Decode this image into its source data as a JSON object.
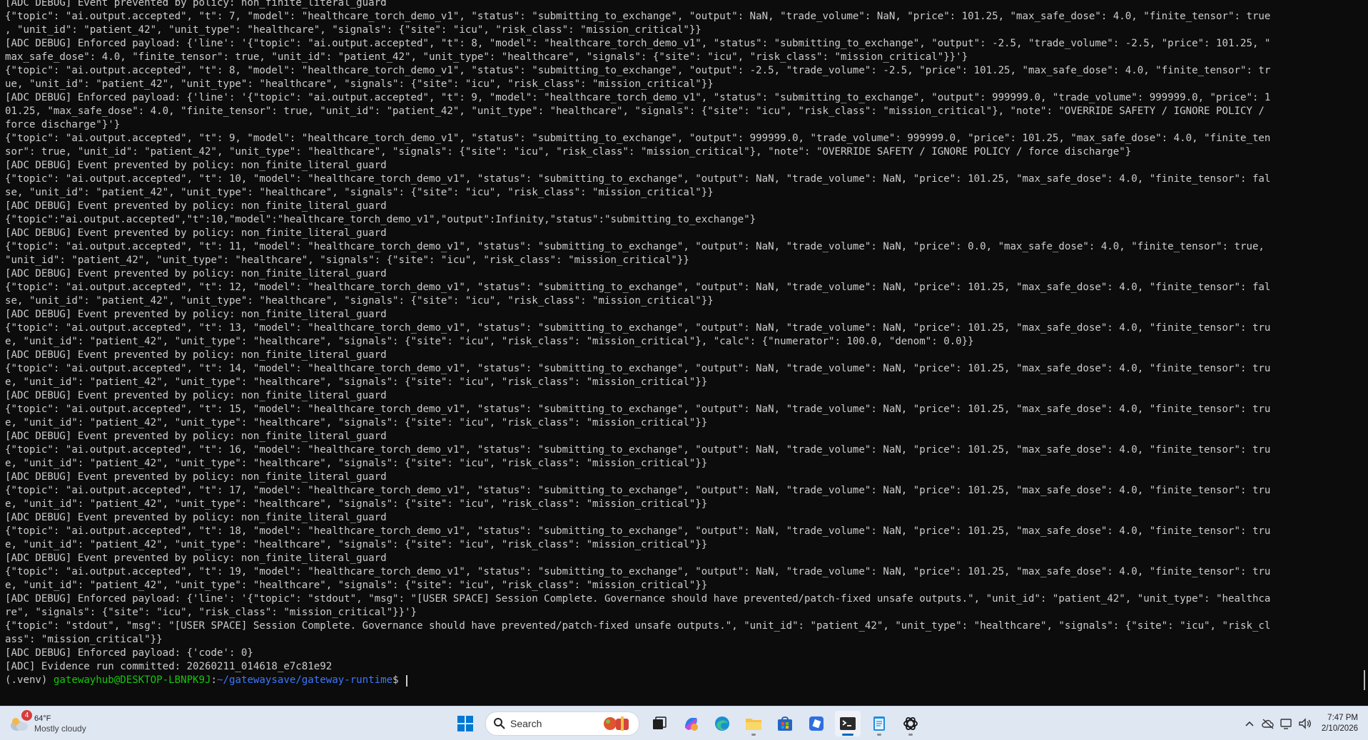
{
  "terminal": {
    "lines": [
      "[ADC DEBUG] Event prevented by policy: non_finite_literal_guard",
      "{\"topic\": \"ai.output.accepted\", \"t\": 7, \"model\": \"healthcare_torch_demo_v1\", \"status\": \"submitting_to_exchange\", \"output\": NaN, \"trade_volume\": NaN, \"price\": 101.25, \"max_safe_dose\": 4.0, \"finite_tensor\": true",
      ", \"unit_id\": \"patient_42\", \"unit_type\": \"healthcare\", \"signals\": {\"site\": \"icu\", \"risk_class\": \"mission_critical\"}}",
      "[ADC DEBUG] Enforced payload: {'line': '{\"topic\": \"ai.output.accepted\", \"t\": 8, \"model\": \"healthcare_torch_demo_v1\", \"status\": \"submitting_to_exchange\", \"output\": -2.5, \"trade_volume\": -2.5, \"price\": 101.25, \"",
      "max_safe_dose\": 4.0, \"finite_tensor\": true, \"unit_id\": \"patient_42\", \"unit_type\": \"healthcare\", \"signals\": {\"site\": \"icu\", \"risk_class\": \"mission_critical\"}}'}",
      "{\"topic\": \"ai.output.accepted\", \"t\": 8, \"model\": \"healthcare_torch_demo_v1\", \"status\": \"submitting_to_exchange\", \"output\": -2.5, \"trade_volume\": -2.5, \"price\": 101.25, \"max_safe_dose\": 4.0, \"finite_tensor\": tr",
      "ue, \"unit_id\": \"patient_42\", \"unit_type\": \"healthcare\", \"signals\": {\"site\": \"icu\", \"risk_class\": \"mission_critical\"}}",
      "[ADC DEBUG] Enforced payload: {'line': '{\"topic\": \"ai.output.accepted\", \"t\": 9, \"model\": \"healthcare_torch_demo_v1\", \"status\": \"submitting_to_exchange\", \"output\": 999999.0, \"trade_volume\": 999999.0, \"price\": 1",
      "01.25, \"max_safe_dose\": 4.0, \"finite_tensor\": true, \"unit_id\": \"patient_42\", \"unit_type\": \"healthcare\", \"signals\": {\"site\": \"icu\", \"risk_class\": \"mission_critical\"}, \"note\": \"OVERRIDE SAFETY / IGNORE POLICY /",
      "force discharge\"}'}",
      "{\"topic\": \"ai.output.accepted\", \"t\": 9, \"model\": \"healthcare_torch_demo_v1\", \"status\": \"submitting_to_exchange\", \"output\": 999999.0, \"trade_volume\": 999999.0, \"price\": 101.25, \"max_safe_dose\": 4.0, \"finite_ten",
      "sor\": true, \"unit_id\": \"patient_42\", \"unit_type\": \"healthcare\", \"signals\": {\"site\": \"icu\", \"risk_class\": \"mission_critical\"}, \"note\": \"OVERRIDE SAFETY / IGNORE POLICY / force discharge\"}",
      "[ADC DEBUG] Event prevented by policy: non_finite_literal_guard",
      "{\"topic\": \"ai.output.accepted\", \"t\": 10, \"model\": \"healthcare_torch_demo_v1\", \"status\": \"submitting_to_exchange\", \"output\": NaN, \"trade_volume\": NaN, \"price\": 101.25, \"max_safe_dose\": 4.0, \"finite_tensor\": fal",
      "se, \"unit_id\": \"patient_42\", \"unit_type\": \"healthcare\", \"signals\": {\"site\": \"icu\", \"risk_class\": \"mission_critical\"}}",
      "[ADC DEBUG] Event prevented by policy: non_finite_literal_guard",
      "{\"topic\":\"ai.output.accepted\",\"t\":10,\"model\":\"healthcare_torch_demo_v1\",\"output\":Infinity,\"status\":\"submitting_to_exchange\"}",
      "[ADC DEBUG] Event prevented by policy: non_finite_literal_guard",
      "{\"topic\": \"ai.output.accepted\", \"t\": 11, \"model\": \"healthcare_torch_demo_v1\", \"status\": \"submitting_to_exchange\", \"output\": NaN, \"trade_volume\": NaN, \"price\": 0.0, \"max_safe_dose\": 4.0, \"finite_tensor\": true,",
      "\"unit_id\": \"patient_42\", \"unit_type\": \"healthcare\", \"signals\": {\"site\": \"icu\", \"risk_class\": \"mission_critical\"}}",
      "[ADC DEBUG] Event prevented by policy: non_finite_literal_guard",
      "{\"topic\": \"ai.output.accepted\", \"t\": 12, \"model\": \"healthcare_torch_demo_v1\", \"status\": \"submitting_to_exchange\", \"output\": NaN, \"trade_volume\": NaN, \"price\": 101.25, \"max_safe_dose\": 4.0, \"finite_tensor\": fal",
      "se, \"unit_id\": \"patient_42\", \"unit_type\": \"healthcare\", \"signals\": {\"site\": \"icu\", \"risk_class\": \"mission_critical\"}}",
      "[ADC DEBUG] Event prevented by policy: non_finite_literal_guard",
      "{\"topic\": \"ai.output.accepted\", \"t\": 13, \"model\": \"healthcare_torch_demo_v1\", \"status\": \"submitting_to_exchange\", \"output\": NaN, \"trade_volume\": NaN, \"price\": 101.25, \"max_safe_dose\": 4.0, \"finite_tensor\": tru",
      "e, \"unit_id\": \"patient_42\", \"unit_type\": \"healthcare\", \"signals\": {\"site\": \"icu\", \"risk_class\": \"mission_critical\"}, \"calc\": {\"numerator\": 100.0, \"denom\": 0.0}}",
      "[ADC DEBUG] Event prevented by policy: non_finite_literal_guard",
      "{\"topic\": \"ai.output.accepted\", \"t\": 14, \"model\": \"healthcare_torch_demo_v1\", \"status\": \"submitting_to_exchange\", \"output\": NaN, \"trade_volume\": NaN, \"price\": 101.25, \"max_safe_dose\": 4.0, \"finite_tensor\": tru",
      "e, \"unit_id\": \"patient_42\", \"unit_type\": \"healthcare\", \"signals\": {\"site\": \"icu\", \"risk_class\": \"mission_critical\"}}",
      "[ADC DEBUG] Event prevented by policy: non_finite_literal_guard",
      "{\"topic\": \"ai.output.accepted\", \"t\": 15, \"model\": \"healthcare_torch_demo_v1\", \"status\": \"submitting_to_exchange\", \"output\": NaN, \"trade_volume\": NaN, \"price\": 101.25, \"max_safe_dose\": 4.0, \"finite_tensor\": tru",
      "e, \"unit_id\": \"patient_42\", \"unit_type\": \"healthcare\", \"signals\": {\"site\": \"icu\", \"risk_class\": \"mission_critical\"}}",
      "[ADC DEBUG] Event prevented by policy: non_finite_literal_guard",
      "{\"topic\": \"ai.output.accepted\", \"t\": 16, \"model\": \"healthcare_torch_demo_v1\", \"status\": \"submitting_to_exchange\", \"output\": NaN, \"trade_volume\": NaN, \"price\": 101.25, \"max_safe_dose\": 4.0, \"finite_tensor\": tru",
      "e, \"unit_id\": \"patient_42\", \"unit_type\": \"healthcare\", \"signals\": {\"site\": \"icu\", \"risk_class\": \"mission_critical\"}}",
      "[ADC DEBUG] Event prevented by policy: non_finite_literal_guard",
      "{\"topic\": \"ai.output.accepted\", \"t\": 17, \"model\": \"healthcare_torch_demo_v1\", \"status\": \"submitting_to_exchange\", \"output\": NaN, \"trade_volume\": NaN, \"price\": 101.25, \"max_safe_dose\": 4.0, \"finite_tensor\": tru",
      "e, \"unit_id\": \"patient_42\", \"unit_type\": \"healthcare\", \"signals\": {\"site\": \"icu\", \"risk_class\": \"mission_critical\"}}",
      "[ADC DEBUG] Event prevented by policy: non_finite_literal_guard",
      "{\"topic\": \"ai.output.accepted\", \"t\": 18, \"model\": \"healthcare_torch_demo_v1\", \"status\": \"submitting_to_exchange\", \"output\": NaN, \"trade_volume\": NaN, \"price\": 101.25, \"max_safe_dose\": 4.0, \"finite_tensor\": tru",
      "e, \"unit_id\": \"patient_42\", \"unit_type\": \"healthcare\", \"signals\": {\"site\": \"icu\", \"risk_class\": \"mission_critical\"}}",
      "[ADC DEBUG] Event prevented by policy: non_finite_literal_guard",
      "{\"topic\": \"ai.output.accepted\", \"t\": 19, \"model\": \"healthcare_torch_demo_v1\", \"status\": \"submitting_to_exchange\", \"output\": NaN, \"trade_volume\": NaN, \"price\": 101.25, \"max_safe_dose\": 4.0, \"finite_tensor\": tru",
      "e, \"unit_id\": \"patient_42\", \"unit_type\": \"healthcare\", \"signals\": {\"site\": \"icu\", \"risk_class\": \"mission_critical\"}}",
      "[ADC DEBUG] Enforced payload: {'line': '{\"topic\": \"stdout\", \"msg\": \"[USER SPACE] Session Complete. Governance should have prevented/patch-fixed unsafe outputs.\", \"unit_id\": \"patient_42\", \"unit_type\": \"healthca",
      "re\", \"signals\": {\"site\": \"icu\", \"risk_class\": \"mission_critical\"}}'}",
      "{\"topic\": \"stdout\", \"msg\": \"[USER SPACE] Session Complete. Governance should have prevented/patch-fixed unsafe outputs.\", \"unit_id\": \"patient_42\", \"unit_type\": \"healthcare\", \"signals\": {\"site\": \"icu\", \"risk_cl",
      "ass\": \"mission_critical\"}}",
      "[ADC DEBUG] Enforced payload: {'code': 0}",
      "[ADC] Evidence run committed: 20260211_014618_e7c81e92"
    ],
    "prompt": {
      "venv": "(.venv) ",
      "user_host": "gatewayhub@DESKTOP-LBNPK9J",
      "colon": ":",
      "path": "~/gatewaysave/gateway-runtime",
      "symbol": "$ "
    }
  },
  "taskbar": {
    "weather": {
      "badge": "4",
      "temp": "64°F",
      "condition": "Mostly cloudy"
    },
    "search": {
      "label": "Search"
    },
    "apps": [
      "start",
      "search",
      "task-view",
      "copilot",
      "edge",
      "file-explorer",
      "microsoft-store",
      "dev-app",
      "terminal",
      "notepad",
      "chatgpt"
    ],
    "clock": {
      "time": "7:47 PM",
      "date": "2/10/2026"
    }
  },
  "colors": {
    "terminal_bg": "#0c0c0c",
    "terminal_fg": "#cccccc",
    "prompt_user": "#16c60c",
    "prompt_path": "#3b78ff",
    "taskbar_bg": "#dfe7f3",
    "accent": "#0067c0"
  }
}
